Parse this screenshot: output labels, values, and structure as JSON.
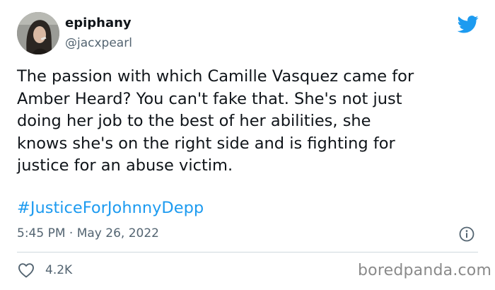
{
  "author": {
    "display_name": "epiphany",
    "handle": "@jacxpearl",
    "avatar_icon": "profile-photo"
  },
  "tweet": {
    "text": "The passion with which Camille Vasquez came for\nAmber Heard? You can't fake that. She's not just\ndoing her job to the best of her abilities, she\nknows she's on the right side and is fighting for\njustice for an abuse victim.",
    "hashtag": "#JusticeForJohnnyDepp",
    "timestamp": "5:45 PM · May 26, 2022",
    "likes": "4.2K"
  },
  "watermark": "boredpanda.com",
  "icons": {
    "brand": "twitter-bird-icon",
    "info": "info-icon",
    "like": "heart-icon"
  },
  "colors": {
    "accent": "#1d9bf0",
    "muted": "#536471",
    "text": "#0f1419",
    "divider": "#cfd9de"
  }
}
